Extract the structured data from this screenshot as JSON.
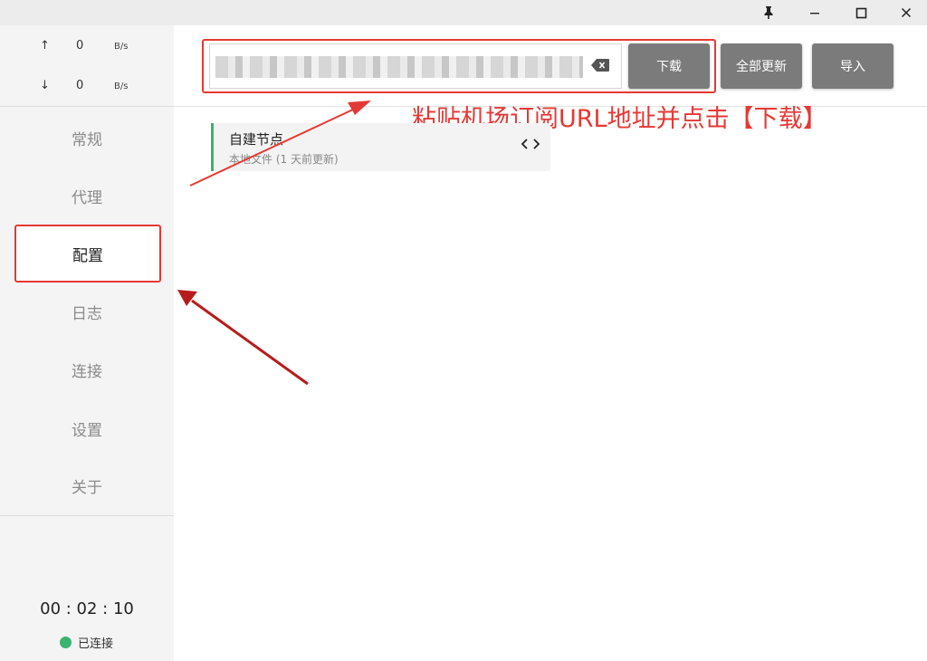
{
  "titlebar": {
    "icons": [
      "pin-icon",
      "minimize-icon",
      "maximize-icon",
      "close-icon"
    ]
  },
  "sidebar": {
    "traffic": {
      "up": {
        "arrow": "↑",
        "value": "0",
        "unit": "B/s"
      },
      "down": {
        "arrow": "↓",
        "value": "0",
        "unit": "B/s"
      }
    },
    "items": [
      {
        "label": "常规"
      },
      {
        "label": "代理"
      },
      {
        "label": "配置"
      },
      {
        "label": "日志"
      },
      {
        "label": "连接"
      },
      {
        "label": "设置"
      },
      {
        "label": "关于"
      }
    ],
    "active_index": 2,
    "timer": "00 : 02 : 10",
    "status": {
      "label": "已连接",
      "color": "#3bb371"
    }
  },
  "toolbar": {
    "url_value": "",
    "download_label": "下载",
    "update_all_label": "全部更新",
    "import_label": "导入"
  },
  "annotation": "粘贴机场订阅URL地址并点击【下载】",
  "profile": {
    "name": "自建节点",
    "subtitle": "本地文件 (1 天前更新)"
  },
  "colors": {
    "accent_red": "#e53935",
    "button_gray": "#7b7b7b",
    "sidebar_bg": "#f4f4f4",
    "connected_green": "#3bb371"
  }
}
